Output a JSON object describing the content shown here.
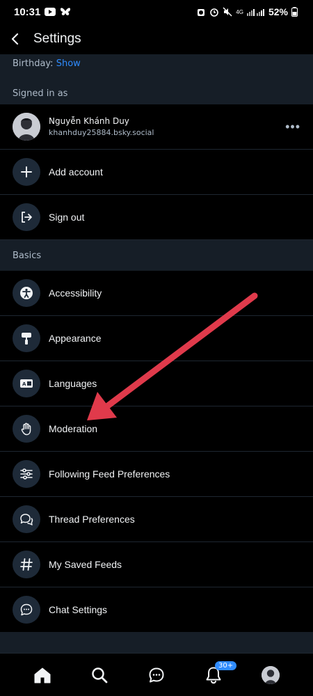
{
  "status_bar": {
    "time": "10:31",
    "network": "4G",
    "battery": "52%",
    "icons": [
      "youtube-icon",
      "butterfly-icon",
      "alarm-icon",
      "mute-icon",
      "signal-icon",
      "battery-icon"
    ]
  },
  "header": {
    "title": "Settings"
  },
  "birthday": {
    "label": "Birthday:",
    "link": "Show"
  },
  "signed_in": {
    "section_title": "Signed in as",
    "account": {
      "name": "Nguyễn Khánh Duy",
      "handle": "khanhduy25884.bsky.social"
    },
    "add_account": "Add account",
    "sign_out": "Sign out"
  },
  "basics": {
    "section_title": "Basics",
    "items": [
      {
        "label": "Accessibility",
        "icon": "accessibility-icon"
      },
      {
        "label": "Appearance",
        "icon": "paint-roller-icon"
      },
      {
        "label": "Languages",
        "icon": "language-icon"
      },
      {
        "label": "Moderation",
        "icon": "hand-icon"
      },
      {
        "label": "Following Feed Preferences",
        "icon": "sliders-icon"
      },
      {
        "label": "Thread Preferences",
        "icon": "chat-bubbles-icon"
      },
      {
        "label": "My Saved Feeds",
        "icon": "hashtag-icon"
      },
      {
        "label": "Chat Settings",
        "icon": "chat-icon"
      }
    ]
  },
  "nav": {
    "items": [
      "home-icon",
      "search-icon",
      "messages-icon",
      "notifications-icon",
      "profile-avatar"
    ],
    "notification_badge": "30+"
  },
  "colors": {
    "background": "#000000",
    "section_bg": "#161e27",
    "icon_circle": "#1e2a38",
    "accent": "#2f8cff",
    "arrow": "#e03a4b"
  }
}
